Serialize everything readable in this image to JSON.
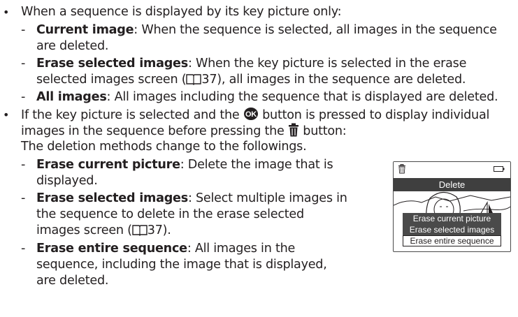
{
  "bullet_char": "•",
  "dash_char": "-",
  "items": [
    {
      "text": "When a sequence is displayed by its key picture only:"
    },
    {
      "term": "Current image",
      "rest": ": When the sequence is selected, all images in the sequence",
      "cont": [
        "are deleted."
      ]
    },
    {
      "term": "Erase selected images",
      "rest": ": When the key picture is selected in the erase",
      "cont_pre": "selected images screen (",
      "page": "37",
      "cont_post": "), all images in the sequence are deleted."
    },
    {
      "term": "All images",
      "rest": ": All images including the sequence that is displayed are deleted."
    },
    {
      "l1_pre": "If the key picture is selected and the ",
      "l1_post": " button is pressed to display individual",
      "l2_pre": "images in the sequence before pressing the ",
      "l2_post": " button:",
      "l3": "The deletion methods change to the followings."
    },
    {
      "term": "Erase current picture",
      "rest": ": Delete the image that is",
      "cont": [
        "displayed."
      ]
    },
    {
      "term": "Erase selected images",
      "rest": ": Select multiple images in",
      "cont": [
        "the sequence to delete in the erase selected"
      ],
      "cont_pre": "images screen (",
      "page": "37",
      "cont_post": ")."
    },
    {
      "term": "Erase entire sequence",
      "rest": ": All images in the",
      "cont": [
        "sequence, including the image that is displayed,",
        "are deleted."
      ]
    }
  ],
  "lcd": {
    "title": "Delete",
    "menu": [
      "Erase current picture",
      "Erase selected images",
      "Erase entire sequence"
    ],
    "selected_index": 2
  },
  "icons": [
    "ok-button-icon",
    "trash-icon",
    "book-reference-icon",
    "battery-icon",
    "delete-mode-icon"
  ]
}
